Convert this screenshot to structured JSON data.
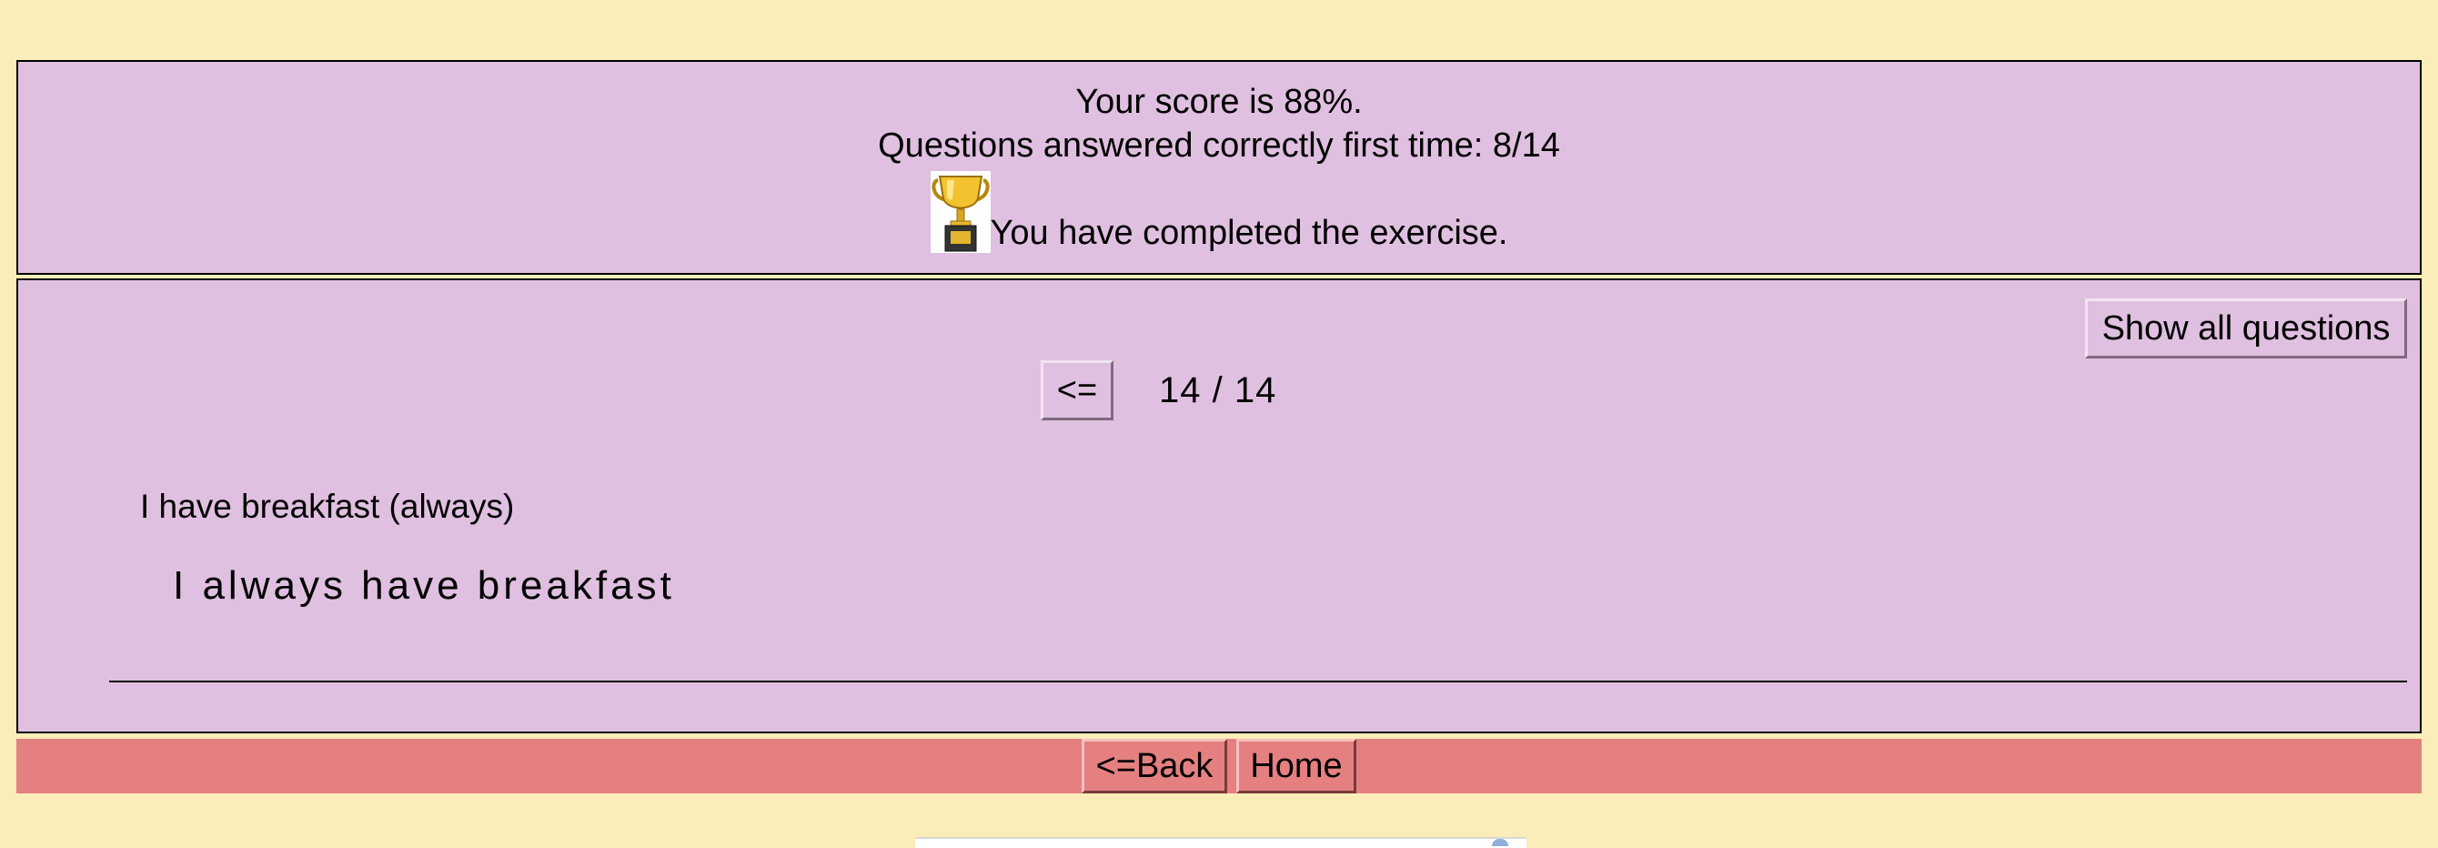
{
  "feedback": {
    "score_text": "Your score is 88%.",
    "first_time_text": "Questions answered correctly first time: 8/14",
    "completed_text": "You have completed the exercise.",
    "trophy_icon": "trophy-icon"
  },
  "question_panel": {
    "show_all_label": "Show all questions",
    "prev_label": "<=",
    "counter": "14 / 14",
    "question": "I have breakfast (always)",
    "answer": "I always have breakfast"
  },
  "navbar": {
    "back_label": "<=Back",
    "home_label": "Home"
  },
  "colors": {
    "page_bg": "#faedb9",
    "panel_bg": "#e0c0e0",
    "navbar_bg": "#e58080",
    "title_red": "#e8211c"
  }
}
